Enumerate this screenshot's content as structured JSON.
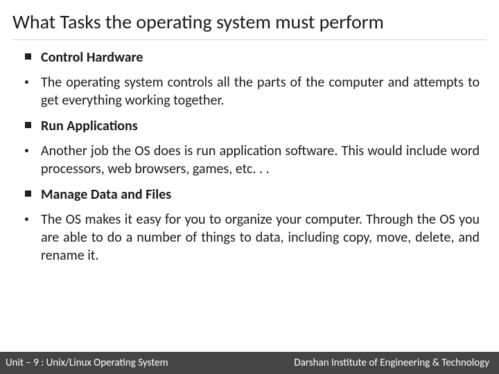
{
  "title": "What Tasks the operating system must perform",
  "sections": [
    {
      "heading": "Control Hardware",
      "body": "The operating system controls all the parts of the computer and attempts to get everything working together."
    },
    {
      "heading": "Run Applications",
      "body": "Another job the OS does is run application software. This would include word processors, web browsers, games, etc. . ."
    },
    {
      "heading": "Manage Data and Files",
      "body": "The OS makes it easy for you to organize your computer. Through the OS you are able to do a number of things to data, including copy, move, delete, and rename it."
    }
  ],
  "footer": {
    "left": "Unit – 9  : Unix/Linux Operating System",
    "right": "Darshan Institute of Engineering & Technology"
  }
}
